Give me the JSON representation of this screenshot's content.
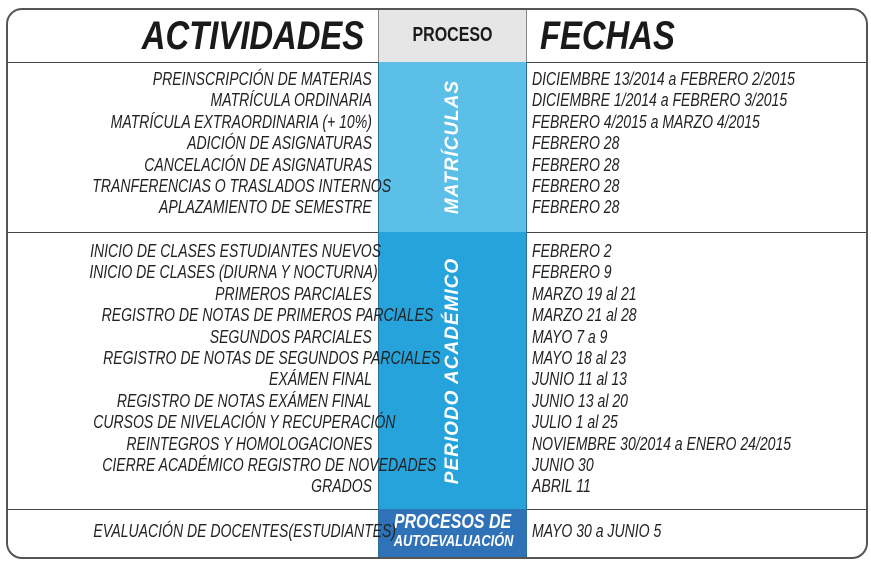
{
  "header": {
    "activities": "ACTIVIDADES",
    "process": "PROCESO",
    "dates": "FECHAS"
  },
  "colors": {
    "matriculas": "#5bbfe8",
    "periodo": "#27a3dc",
    "autoevaluacion": "#2f72b8",
    "header_process_bg": "#e6e6e6"
  },
  "sections": [
    {
      "process": "MATRÍCULAS",
      "rows": [
        {
          "activity": "PREINSCRIPCIÓN DE MATERIAS",
          "date": "DICIEMBRE 13/2014 a FEBRERO 2/2015"
        },
        {
          "activity": "MATRÍCULA ORDINARIA",
          "date": "DICIEMBRE 1/2014 a FEBRERO 3/2015"
        },
        {
          "activity": "MATRÍCULA EXTRAORDINARIA (+ 10%)",
          "date": "FEBRERO 4/2015 a MARZO 4/2015"
        },
        {
          "activity": "ADICIÓN DE ASIGNATURAS",
          "date": "FEBRERO 28"
        },
        {
          "activity": "CANCELACIÓN DE ASIGNATURAS",
          "date": "FEBRERO 28"
        },
        {
          "activity": "TRANFERENCIAS O TRASLADOS INTERNOS",
          "date": "FEBRERO 28"
        },
        {
          "activity": "APLAZAMIENTO DE SEMESTRE",
          "date": "FEBRERO 28"
        }
      ]
    },
    {
      "process": "PERIODO ACADÉMICO",
      "rows": [
        {
          "activity": "INICIO DE CLASES ESTUDIANTES NUEVOS",
          "date": "FEBRERO 2"
        },
        {
          "activity": "INICIO DE CLASES (DIURNA Y NOCTURNA)",
          "date": "FEBRERO 9"
        },
        {
          "activity": "PRIMEROS PARCIALES",
          "date": "MARZO 19 al 21"
        },
        {
          "activity": "REGISTRO DE NOTAS DE PRIMEROS PARCIALES",
          "date": "MARZO 21 al 28"
        },
        {
          "activity": "SEGUNDOS PARCIALES",
          "date": "MAYO 7 a 9"
        },
        {
          "activity": "REGISTRO DE NOTAS DE SEGUNDOS PARCIALES",
          "date": "MAYO 18 al 23"
        },
        {
          "activity": "EXÁMEN FINAL",
          "date": "JUNIO 11 al 13"
        },
        {
          "activity": "REGISTRO DE NOTAS EXÁMEN FINAL",
          "date": "JUNIO 13 al 20"
        },
        {
          "activity": "CURSOS DE NIVELACIÓN Y RECUPERACIÓN",
          "date": "JULIO 1 al 25"
        },
        {
          "activity": "REINTEGROS Y HOMOLOGACIONES",
          "date": "NOVIEMBRE 30/2014 a ENERO 24/2015"
        },
        {
          "activity": "CIERRE ACADÉMICO REGISTRO DE NOVEDADES",
          "date": "JUNIO 30"
        },
        {
          "activity": "GRADOS",
          "date": "ABRIL 11"
        }
      ]
    },
    {
      "process_line1": "PROCESOS DE",
      "process_line2": "AUTOEVALUACIÓN",
      "rows": [
        {
          "activity": "EVALUACIÓN DE DOCENTES(ESTUDIANTES)",
          "date": "MAYO 30 a JUNIO 5"
        }
      ]
    }
  ]
}
